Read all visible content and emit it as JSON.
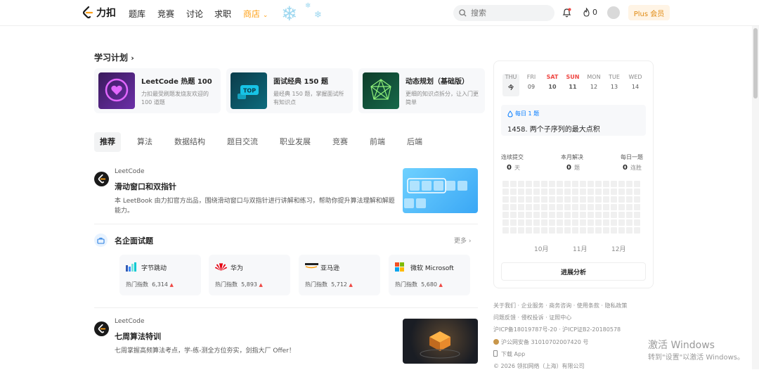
{
  "nav": {
    "logo_text": "力扣",
    "items": [
      "题库",
      "竞赛",
      "讨论",
      "求职"
    ],
    "shop": "商店",
    "search_placeholder": "搜索",
    "flame_count": "0",
    "plus": "Plus 会员"
  },
  "plans": {
    "title": "学习计划",
    "cards": [
      {
        "title": "LeetCode 热题 100",
        "desc": "力扣最受刷题发烧友欢迎的 100 道题"
      },
      {
        "title": "面试经典 150 题",
        "desc": "最经典 150 题，掌握面试所有知识点"
      },
      {
        "title": "动态规划（基础版）",
        "desc": "更细的知识点拆分，让入门更简单"
      }
    ]
  },
  "tabs": [
    "推荐",
    "算法",
    "数据结构",
    "题目交流",
    "职业发展",
    "竞赛",
    "前端",
    "后端"
  ],
  "feed": [
    {
      "source": "LeetCode",
      "title": "滑动窗口和双指针",
      "desc": "本 LeetBook 由力扣官方出品，围绕滑动窗口与双指针进行讲解和练习，帮助你提升算法理解和解题能力。"
    },
    {
      "source": "LeetCode",
      "title": "七周算法特训",
      "desc": "七周掌握高频算法考点，学-练-测全方位夯实，剑指大厂 Offer！"
    }
  ],
  "companies": {
    "title": "名企面试题",
    "more": "更多",
    "hot_label": "热门指数",
    "items": [
      {
        "name": "字节跳动",
        "hot": "6,314"
      },
      {
        "name": "华为",
        "hot": "5,893"
      },
      {
        "name": "亚马逊",
        "hot": "5,712"
      },
      {
        "name": "微软 Microsoft",
        "hot": "5,680"
      }
    ]
  },
  "calendar": {
    "days": [
      {
        "w": "THU",
        "d": "今"
      },
      {
        "w": "FRI",
        "d": "09"
      },
      {
        "w": "SAT",
        "d": "10"
      },
      {
        "w": "SUN",
        "d": "11"
      },
      {
        "w": "MON",
        "d": "12"
      },
      {
        "w": "TUE",
        "d": "13"
      },
      {
        "w": "WED",
        "d": "14"
      }
    ],
    "daily_label": "每日 1 题",
    "daily_question": "1458. 两个子序列的最大点积",
    "stats": [
      {
        "label": "连续提交",
        "value": "0",
        "unit": "天"
      },
      {
        "label": "本月解决",
        "value": "0",
        "unit": "题"
      },
      {
        "label": "每日一题",
        "value": "0",
        "unit": "连胜"
      }
    ],
    "months": [
      "10月",
      "11月",
      "12月"
    ],
    "progress_button": "进展分析"
  },
  "footer": {
    "line1": "关于我们 · 企业服务 · 商务咨询 · 使用条款 · 隐私政策",
    "line2": "问题反馈 · 侵权投诉 · 证照中心",
    "line3": "沪ICP备18019787号-20 · 沪ICP证B2-20180578",
    "line4": "沪公网安备 31010702007420 号",
    "line5": "下载 App",
    "line6": "© 2026 领扣网络（上海）有限公司"
  },
  "watermark": {
    "line1": "激活 Windows",
    "line2": "转到\"设置\"以激活 Windows。"
  },
  "colors": {
    "accent": "#ffa116",
    "link": "#007aff",
    "hot": "#ef4743"
  }
}
